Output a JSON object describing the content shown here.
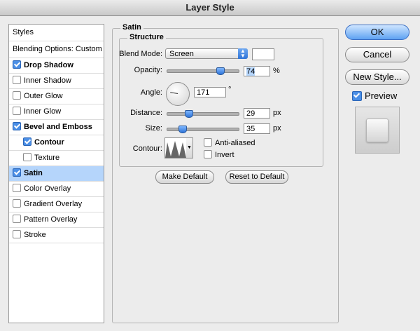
{
  "window": {
    "title": "Layer Style"
  },
  "styles_list": {
    "header": "Styles",
    "blending": "Blending Options: Custom",
    "items": [
      {
        "label": "Drop Shadow",
        "checked": true
      },
      {
        "label": "Inner Shadow",
        "checked": false
      },
      {
        "label": "Outer Glow",
        "checked": false
      },
      {
        "label": "Inner Glow",
        "checked": false
      },
      {
        "label": "Bevel and Emboss",
        "checked": true
      },
      {
        "label": "Contour",
        "checked": true
      },
      {
        "label": "Texture",
        "checked": false
      },
      {
        "label": "Satin",
        "checked": true
      },
      {
        "label": "Color Overlay",
        "checked": false
      },
      {
        "label": "Gradient Overlay",
        "checked": false
      },
      {
        "label": "Pattern Overlay",
        "checked": false
      },
      {
        "label": "Stroke",
        "checked": false
      }
    ]
  },
  "satin": {
    "group_title": "Satin",
    "structure_title": "Structure",
    "blend_mode_label": "Blend Mode:",
    "blend_mode_value": "Screen",
    "color_swatch": "#ffffff",
    "opacity_label": "Opacity:",
    "opacity_value": "74",
    "opacity_unit": "%",
    "angle_label": "Angle:",
    "angle_value": "171",
    "angle_unit": "°",
    "distance_label": "Distance:",
    "distance_value": "29",
    "distance_unit": "px",
    "size_label": "Size:",
    "size_value": "35",
    "size_unit": "px",
    "contour_label": "Contour:",
    "anti_aliased_label": "Anti-aliased",
    "invert_label": "Invert",
    "make_default_label": "Make Default",
    "reset_default_label": "Reset to Default"
  },
  "buttons": {
    "ok": "OK",
    "cancel": "Cancel",
    "new_style": "New Style...",
    "preview_label": "Preview",
    "preview_checked": true
  },
  "colors": {
    "accent": "#4a8ee6",
    "selected_row": "#b5d5fb",
    "background": "#ececec"
  }
}
